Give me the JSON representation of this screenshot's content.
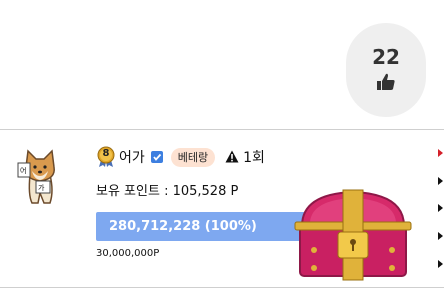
{
  "like": {
    "count": "22",
    "icon": "thumbs-up-icon"
  },
  "user": {
    "level": "8",
    "name": "어가",
    "badge": "베테랑",
    "warning_count": "1회",
    "points_label": "보유 포인트 : 105,528 P",
    "avatar_caption": "어가"
  },
  "progress": {
    "label": "280,712,228 (100%)",
    "percent": 100,
    "target": "30,000,000P",
    "color": "#7ea8f0"
  },
  "colors": {
    "beta_tag_bg": "#fde2d2",
    "verified": "#3d7fe0",
    "chest_body": "#d62a6a",
    "chest_trim": "#e0b23a"
  }
}
